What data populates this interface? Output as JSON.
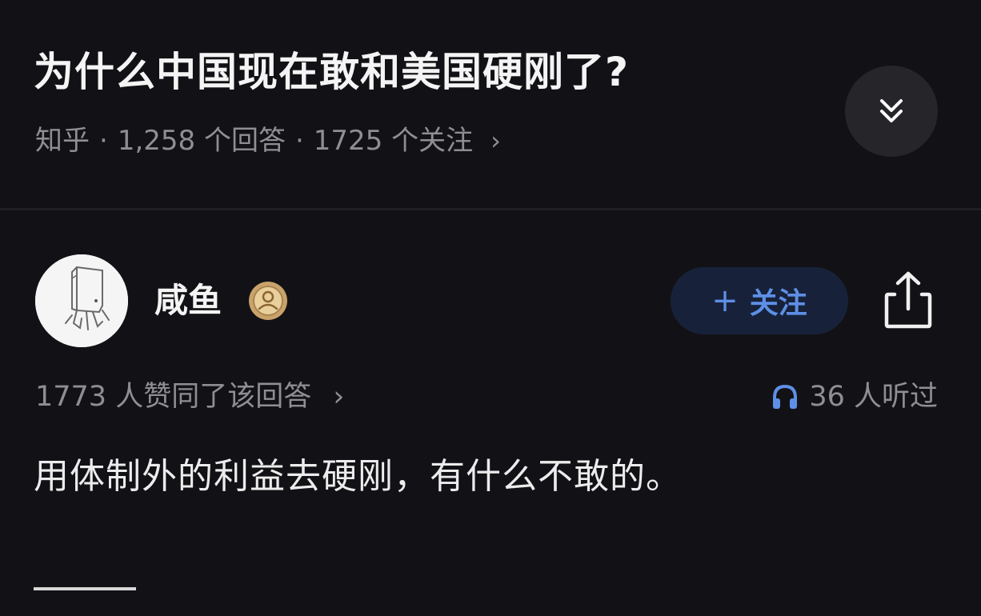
{
  "question": {
    "title": "为什么中国现在敢和美国硬刚了?",
    "source": "知乎",
    "separator": "·",
    "answers_count": "1,258 个回答",
    "followers_count": "1725 个关注",
    "chevron": "›"
  },
  "answer": {
    "author_name": "咸鱼",
    "follow_label": "关注",
    "follow_plus": "+",
    "votes_text": "1773 人赞同了该回答",
    "votes_chevron": "›",
    "listen_text": "36 人听过",
    "content": "用体制外的利益去硬刚，有什么不敢的。"
  },
  "colors": {
    "background": "#121216",
    "accent": "#5e8fe6",
    "muted": "#8e8e93",
    "badge": "#c9a36a"
  },
  "icons": {
    "collapse": "double-chevron-down-icon",
    "share": "share-icon",
    "listen": "headphones-icon",
    "badge": "user-badge-icon"
  }
}
